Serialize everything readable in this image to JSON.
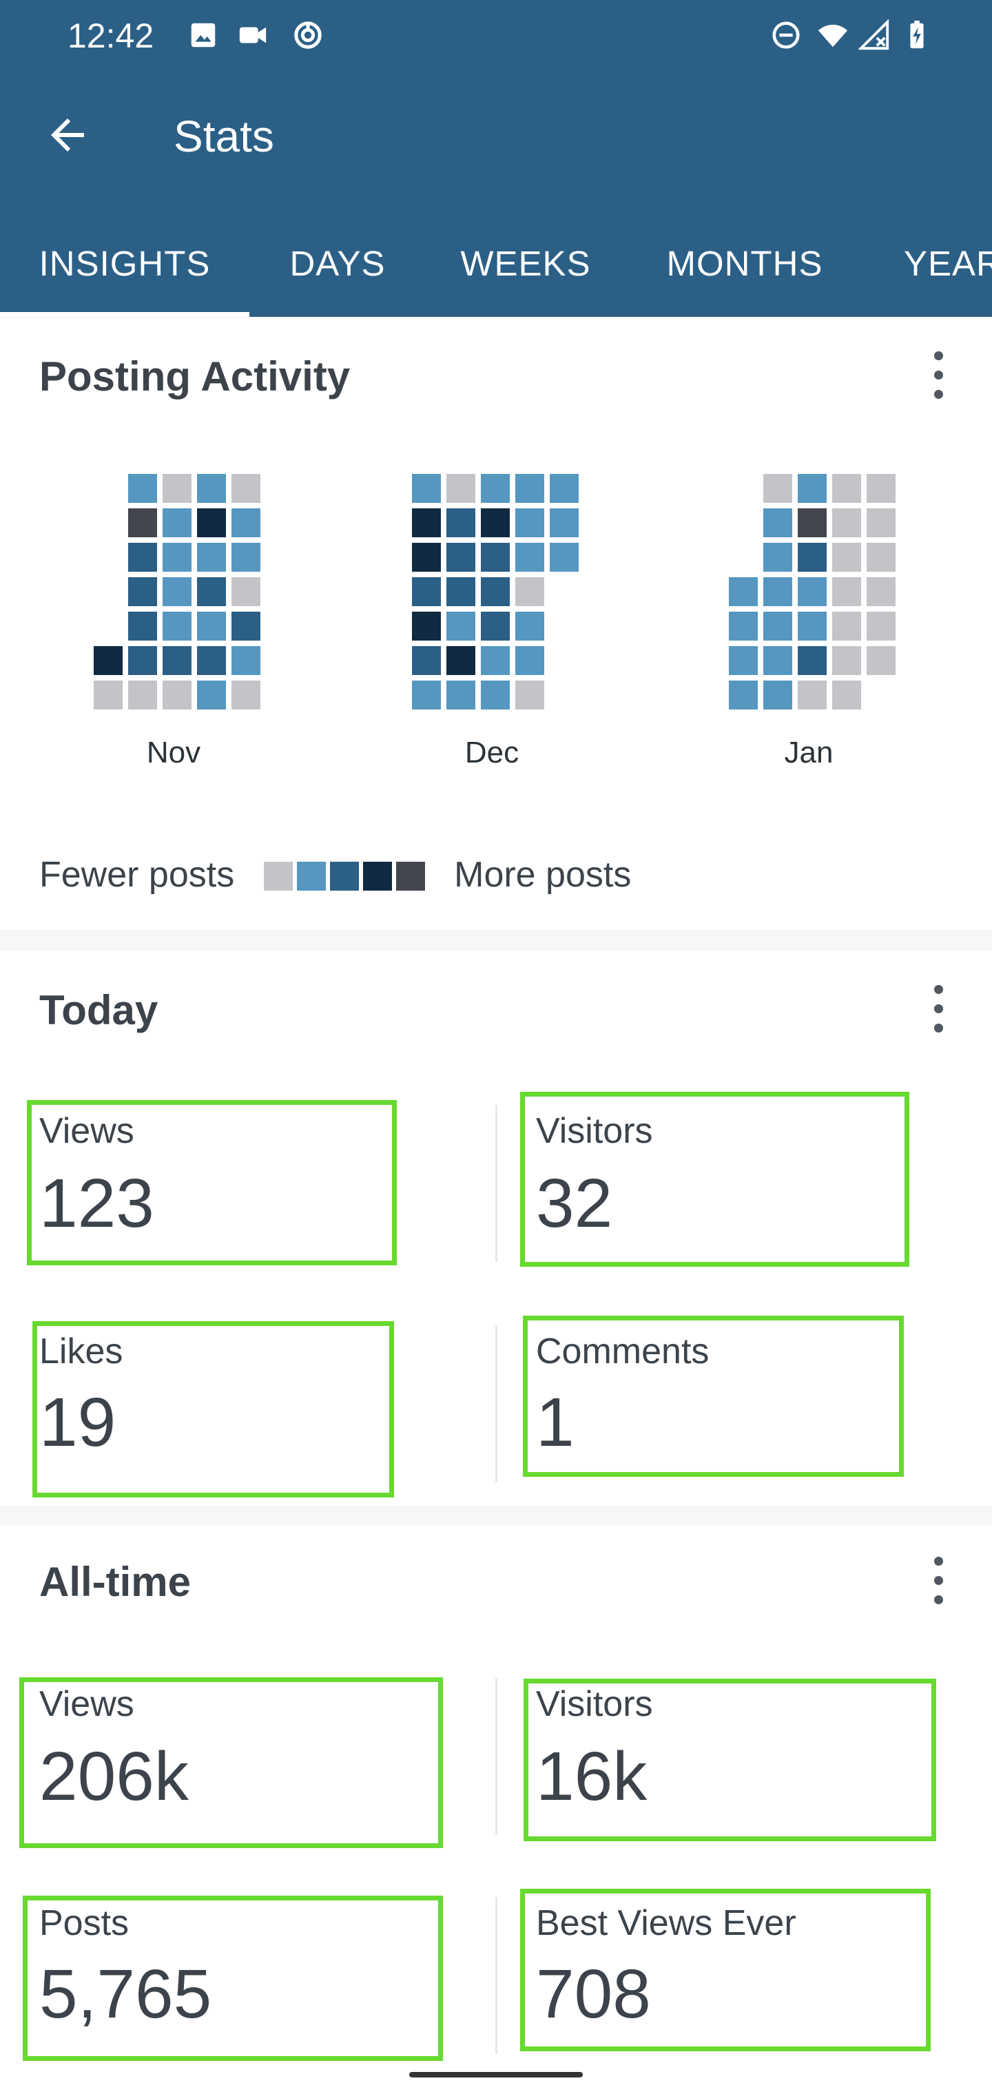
{
  "status_bar": {
    "time": "12:42",
    "icons_left": [
      "image-icon",
      "video-camera-icon",
      "sync-icon"
    ],
    "icons_right": [
      "do-not-disturb-icon",
      "wifi-icon",
      "signal-icon",
      "battery-charging-icon"
    ]
  },
  "app_bar": {
    "title": "Stats",
    "back_icon": "arrow-back-icon",
    "tabs": [
      {
        "label": "INSIGHTS",
        "active": true
      },
      {
        "label": "DAYS",
        "active": false
      },
      {
        "label": "WEEKS",
        "active": false
      },
      {
        "label": "MONTHS",
        "active": false
      },
      {
        "label": "YEARS",
        "active": false
      }
    ]
  },
  "colors": {
    "app_bar": "#2b5f86",
    "level_0": "#c3c4c7",
    "level_1": "#5597c0",
    "level_2": "#2b5f86",
    "level_3": "#102a43",
    "level_4": "#43474d",
    "highlight": "#67d92f"
  },
  "posting_activity": {
    "title": "Posting Activity",
    "months": [
      {
        "label": "Nov",
        "weeks": [
          [
            null,
            null,
            null,
            null,
            null,
            3,
            0
          ],
          [
            1,
            4,
            2,
            2,
            2,
            2,
            0
          ],
          [
            0,
            1,
            1,
            1,
            1,
            2,
            0
          ],
          [
            1,
            3,
            1,
            2,
            1,
            2,
            1
          ],
          [
            0,
            1,
            1,
            0,
            2,
            1,
            0
          ]
        ]
      },
      {
        "label": "Dec",
        "weeks": [
          [
            1,
            3,
            3,
            2,
            3,
            2,
            1
          ],
          [
            0,
            2,
            2,
            2,
            1,
            3,
            1
          ],
          [
            1,
            3,
            2,
            2,
            2,
            1,
            1
          ],
          [
            1,
            1,
            1,
            0,
            1,
            1,
            0
          ],
          [
            1,
            1,
            1,
            null,
            null,
            null,
            null
          ]
        ]
      },
      {
        "label": "Jan",
        "weeks": [
          [
            null,
            null,
            null,
            1,
            1,
            1,
            1
          ],
          [
            0,
            1,
            1,
            1,
            1,
            1,
            1
          ],
          [
            1,
            4,
            2,
            1,
            1,
            2,
            0
          ],
          [
            0,
            0,
            0,
            0,
            0,
            0,
            0
          ],
          [
            0,
            0,
            0,
            0,
            0,
            0,
            null
          ]
        ]
      }
    ],
    "legend": {
      "fewer": "Fewer posts",
      "more": "More posts",
      "levels": [
        0,
        1,
        2,
        3,
        4
      ]
    }
  },
  "today": {
    "title": "Today",
    "stats": [
      {
        "label": "Views",
        "value": "123"
      },
      {
        "label": "Visitors",
        "value": "32"
      },
      {
        "label": "Likes",
        "value": "19"
      },
      {
        "label": "Comments",
        "value": "1"
      }
    ]
  },
  "all_time": {
    "title": "All-time",
    "stats": [
      {
        "label": "Views",
        "value": "206k"
      },
      {
        "label": "Visitors",
        "value": "16k"
      },
      {
        "label": "Posts",
        "value": "5,765"
      },
      {
        "label": "Best Views Ever",
        "value": "708"
      }
    ]
  }
}
